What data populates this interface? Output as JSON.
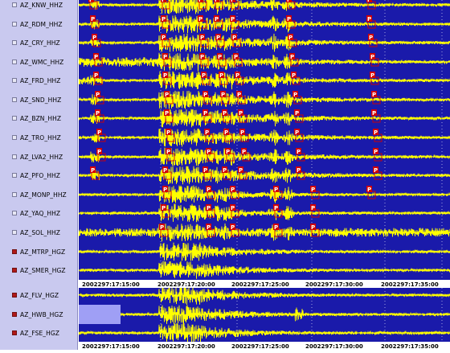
{
  "colors": {
    "panel_bg": "#c9c9ef",
    "trace_bg": "#1a1aaa",
    "trace": "#ffff00",
    "pick_box": "#d40000",
    "time_bar": "#ffffff",
    "checkbox_selected": "#b01818"
  },
  "channels": [
    {
      "label": "AZ_KNW_HHZ",
      "checked": false
    },
    {
      "label": "AZ_RDM_HHZ",
      "checked": false
    },
    {
      "label": "AZ_CRY_HHZ",
      "checked": false
    },
    {
      "label": "AZ_WMC_HHZ",
      "checked": false
    },
    {
      "label": "AZ_FRD_HHZ",
      "checked": false
    },
    {
      "label": "AZ_SND_HHZ",
      "checked": false
    },
    {
      "label": "AZ_BZN_HHZ",
      "checked": false
    },
    {
      "label": "AZ_TRO_HHZ",
      "checked": false
    },
    {
      "label": "AZ_LVA2_HHZ",
      "checked": false
    },
    {
      "label": "AZ_PFO_HHZ",
      "checked": false
    },
    {
      "label": "AZ_MONP_HHZ",
      "checked": false
    },
    {
      "label": "AZ_YAQ_HHZ",
      "checked": false
    },
    {
      "label": "AZ_SOL_HHZ",
      "checked": false
    },
    {
      "label": "AZ_MTRP_HGZ",
      "checked": true
    },
    {
      "label": "AZ_SMER_HGZ",
      "checked": true
    },
    {
      "label": "AZ_FLV_HGZ",
      "checked": true
    },
    {
      "label": "AZ_HWB_HGZ",
      "checked": true
    },
    {
      "label": "AZ_FSE_HGZ",
      "checked": true
    }
  ],
  "time_axis": {
    "upper_labels": [
      "2002297:17:15:00",
      "2002297:17:20:00",
      "2002297:17:25:00",
      "2002297:17:30:00",
      "2002297:17:35:00"
    ],
    "lower_labels": [
      "2002297:17:15:00",
      "2002297:17:20:00",
      "2002297:17:25:00",
      "2002297:17:30:00",
      "2002297:17:35:00"
    ]
  },
  "pick_marker_label": "P"
}
